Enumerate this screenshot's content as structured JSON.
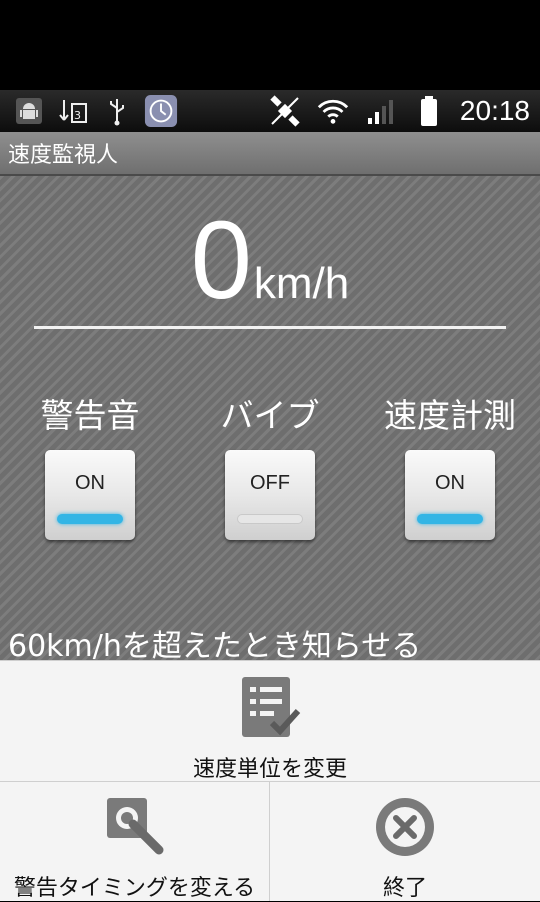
{
  "status_bar": {
    "icons": [
      "android-debug-icon",
      "usb-storage-icon",
      "usb-icon",
      "app-notification-icon"
    ],
    "right_icons": [
      "gps-satellite-icon",
      "wifi-icon",
      "signal-icon",
      "battery-icon"
    ],
    "time": "20:18"
  },
  "app": {
    "title": "速度監視人"
  },
  "speed": {
    "value": "0",
    "unit": "km/h"
  },
  "toggles": [
    {
      "label": "警告音",
      "state": "ON",
      "on": true
    },
    {
      "label": "バイブ",
      "state": "OFF",
      "on": false
    },
    {
      "label": "速度計測",
      "state": "ON",
      "on": true
    }
  ],
  "alert_threshold_text": "60km/hを超えたとき知らせる",
  "menu": {
    "change_unit": "速度単位を変更",
    "change_timing": "警告タイミングを変える",
    "exit": "終了"
  },
  "colors": {
    "accent_on": "#33b5e5",
    "background": "#737373"
  }
}
